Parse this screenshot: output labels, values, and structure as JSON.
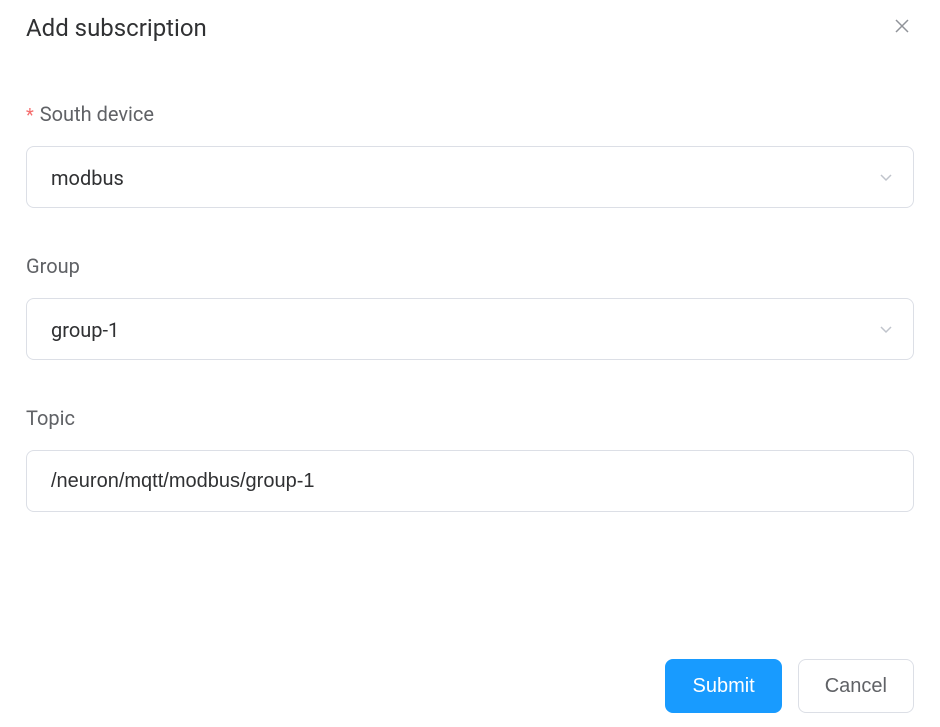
{
  "dialog": {
    "title": "Add subscription"
  },
  "form": {
    "south_device": {
      "label": "South device",
      "required": true,
      "value": "modbus"
    },
    "group": {
      "label": "Group",
      "value": "group-1"
    },
    "topic": {
      "label": "Topic",
      "value": "/neuron/mqtt/modbus/group-1"
    }
  },
  "footer": {
    "submit_label": "Submit",
    "cancel_label": "Cancel"
  }
}
